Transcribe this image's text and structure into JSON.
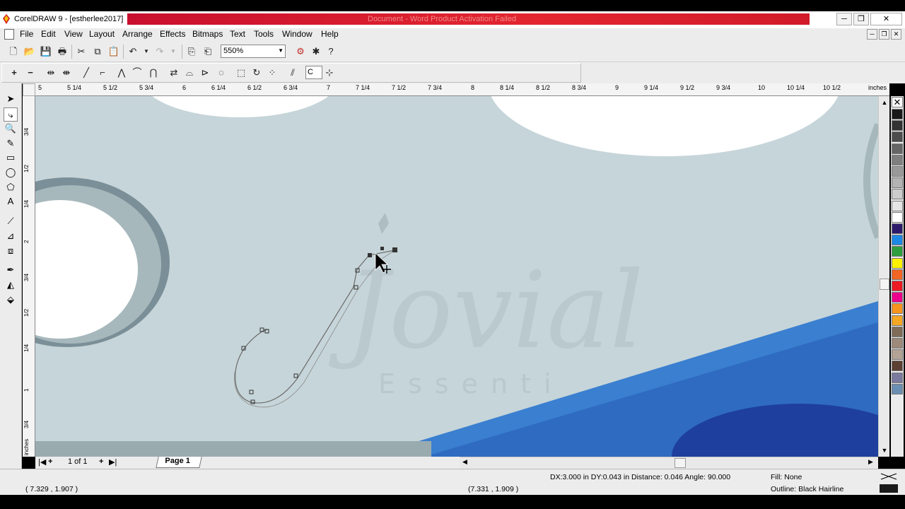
{
  "window": {
    "title": "CorelDRAW 9 - [estherlee2017]",
    "ghost_text": "Document - Word Product Activation Failed",
    "controls": {
      "minimize": "─",
      "restore": "❐",
      "close": "✕"
    },
    "mdi_controls": {
      "minimize": "─",
      "restore": "❐",
      "close": "✕"
    }
  },
  "menu": {
    "items": [
      "File",
      "Edit",
      "View",
      "Layout",
      "Arrange",
      "Effects",
      "Bitmaps",
      "Text",
      "Tools",
      "Window",
      "Help"
    ]
  },
  "toolbar": {
    "zoom_value": "550%",
    "nudge_value": "C"
  },
  "ruler": {
    "unit": "inches",
    "h_labels": [
      "5",
      "5 1/4",
      "5 1/2",
      "5 3/4",
      "6",
      "6 1/4",
      "6 1/2",
      "6 3/4",
      "7",
      "7 1/4",
      "7 1/2",
      "7 3/4",
      "8",
      "8 1/4",
      "8 1/2",
      "8 3/4",
      "9",
      "9 1/4",
      "9 1/2",
      "9 3/4",
      "10",
      "10 1/4",
      "10 1/2"
    ],
    "v_labels": [
      "3/4",
      "1/2",
      "1/4",
      "2",
      "3/4",
      "1/2",
      "1/4",
      "1",
      "3/4"
    ],
    "v_unit": "inches"
  },
  "canvas": {
    "watermark_main": "Jovial",
    "watermark_sub": "Essenti",
    "colors": {
      "sheet": "#c6d5d9",
      "blue": "#2f6fc6",
      "dark_blue": "#1e3f9e",
      "white": "#ffffff"
    }
  },
  "pages": {
    "counter": "1 of 1",
    "tab": "Page 1"
  },
  "status": {
    "cursor_left": "( 7.329 , 1.907 )",
    "cursor_mid": "(7.331 , 1.909 )",
    "measure": "DX:3.000 in DY:0.043 in Distance: 0.046 Angle: 90.000",
    "fill": "Fill: None",
    "outline": "Outline: Black  Hairline"
  },
  "palette": [
    "#1a1a1a",
    "#333333",
    "#4d4d4d",
    "#666666",
    "#7f7f7f",
    "#999999",
    "#b3b3b3",
    "#cccccc",
    "#e5e5e5",
    "#ffffff",
    "#2e1a6b",
    "#1e88e5",
    "#2e9e3e",
    "#fff200",
    "#f26522",
    "#ed1c24",
    "#ec008c",
    "#f7941d",
    "#f5a623",
    "#7f6b57",
    "#9e8a7a",
    "#b3a394",
    "#5c4033",
    "#7a7a9e",
    "#6b8eb3"
  ]
}
